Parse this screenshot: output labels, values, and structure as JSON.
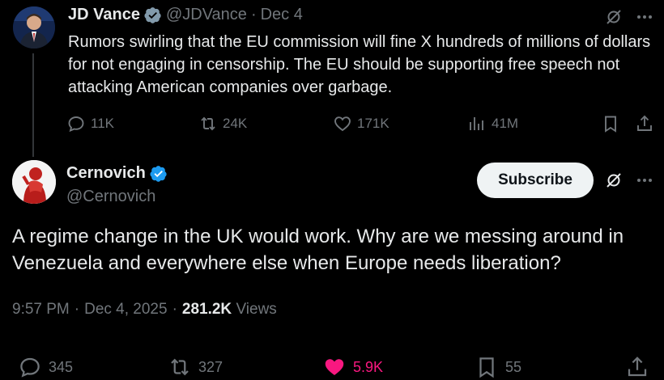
{
  "parent": {
    "name": "JD Vance",
    "handle": "@JDVance",
    "separator": "·",
    "date": "Dec 4",
    "text": "Rumors swirling that the EU commission will fine X hundreds of millions of dollars for not engaging in censorship. The EU should be supporting free speech not attacking American companies over garbage.",
    "actions": {
      "replies": "11K",
      "reposts": "24K",
      "likes": "171K",
      "views": "41M"
    }
  },
  "main": {
    "name": "Cernovich",
    "handle": "@Cernovich",
    "subscribe_label": "Subscribe",
    "text": "A regime change in the UK would work. Why are we messing around in Venezuela and everywhere else when Europe needs liberation?",
    "time": "9:57 PM",
    "separator": "·",
    "date": "Dec 4, 2025",
    "separator2": "·",
    "views_count": "281.2K",
    "views_label": "Views",
    "actions": {
      "replies": "345",
      "reposts": "327",
      "likes": "5.9K",
      "bookmarks": "55"
    }
  },
  "colors": {
    "background": "#000000",
    "text": "#e7e9ea",
    "muted": "#71767b",
    "verified": "#1d9bf0",
    "like_active": "#f91880"
  },
  "icons": [
    "verified-badge-icon",
    "grok-icon",
    "more-icon",
    "reply-icon",
    "repost-icon",
    "like-icon",
    "views-icon",
    "bookmark-icon",
    "share-icon"
  ]
}
